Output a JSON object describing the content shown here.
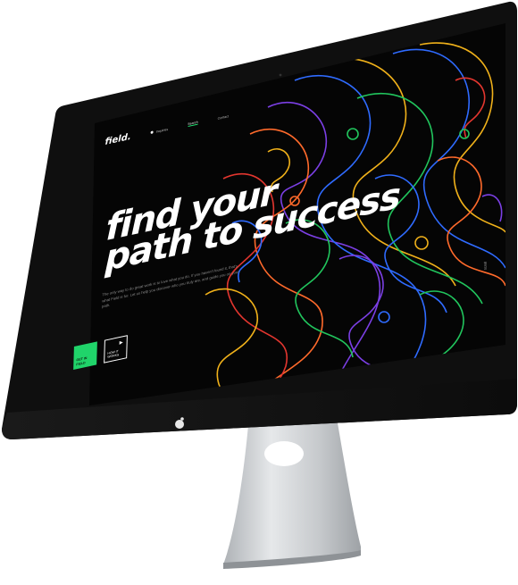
{
  "nav": {
    "logo": "field.",
    "items": [
      {
        "label": "Inquiries"
      },
      {
        "label": "Search"
      },
      {
        "label": "Contact"
      }
    ]
  },
  "hero": {
    "headline_line1": "find your",
    "headline_line2": "path to success",
    "intro": "The only way to do great work is to love what you do. If you haven't found it, that's what Field is for. Let us help you discover who you truly are, and guide you on your path.",
    "primary_button": "GET IN FIELD",
    "secondary_button": "HOW IT WORKS",
    "scroll_label": "scroll"
  },
  "colors": {
    "accent_green": "#20d46a",
    "screen_bg": "#050505",
    "frame": "#141414",
    "stand": "#cfd2d5"
  }
}
